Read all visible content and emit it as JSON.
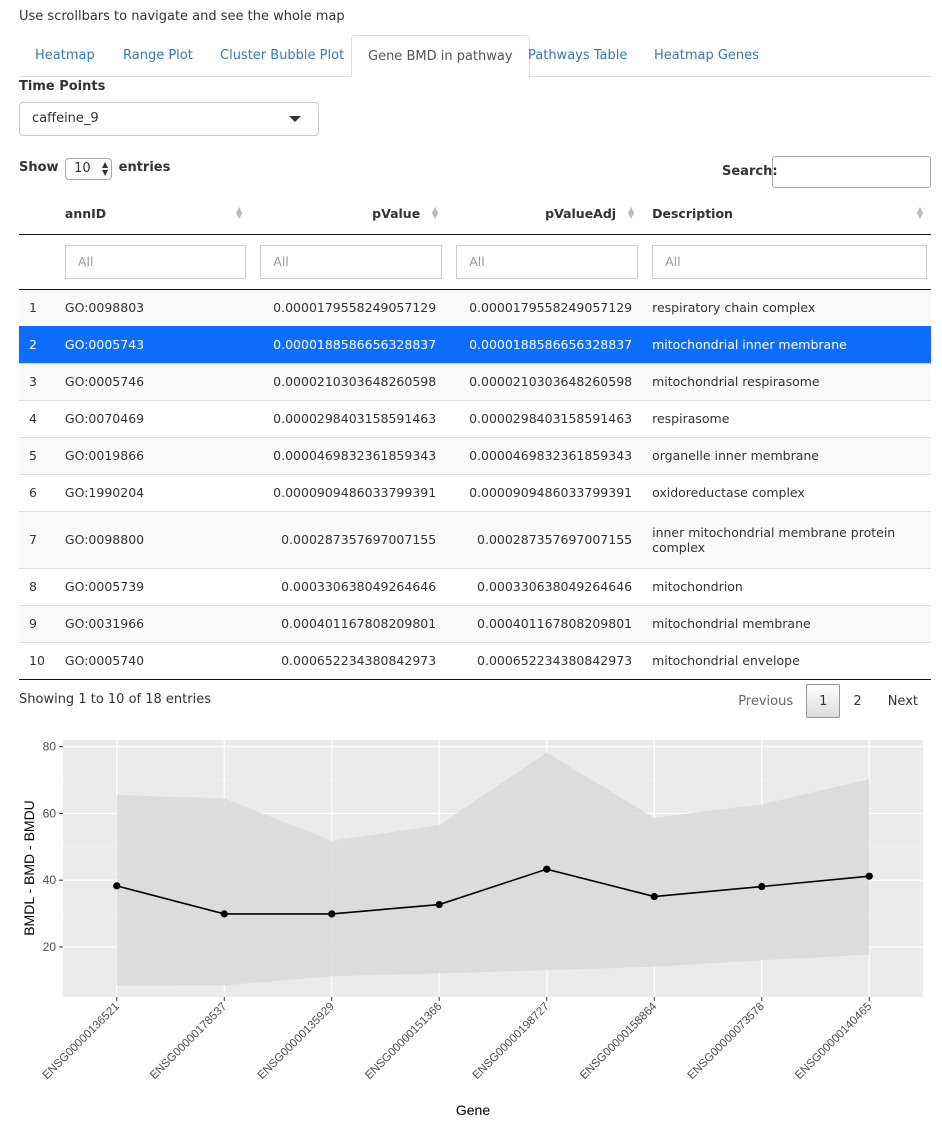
{
  "note": "Use scrollbars to navigate and see the whole map",
  "tabs": [
    "Heatmap",
    "Range Plot",
    "Cluster Bubble Plot",
    "Gene BMD in pathway",
    "Pathways Table",
    "Heatmap Genes"
  ],
  "active_tab": "Gene BMD in pathway",
  "time_points": {
    "label": "Time Points",
    "value": "caffeine_9"
  },
  "table_controls": {
    "show_label": "Show",
    "entries_label": "entries",
    "page_length": "10",
    "search_label": "Search:"
  },
  "columns": [
    "annID",
    "pValue",
    "pValueAdj",
    "Description"
  ],
  "filter_placeholder": "All",
  "rows": [
    {
      "n": "1",
      "annID": "GO:0098803",
      "pValue": "0.0000179558249057129",
      "pValueAdj": "0.0000179558249057129",
      "desc": "respiratory chain complex"
    },
    {
      "n": "2",
      "annID": "GO:0005743",
      "pValue": "0.0000188586656328837",
      "pValueAdj": "0.0000188586656328837",
      "desc": "mitochondrial inner membrane"
    },
    {
      "n": "3",
      "annID": "GO:0005746",
      "pValue": "0.0000210303648260598",
      "pValueAdj": "0.0000210303648260598",
      "desc": "mitochondrial respirasome"
    },
    {
      "n": "4",
      "annID": "GO:0070469",
      "pValue": "0.0000298403158591463",
      "pValueAdj": "0.0000298403158591463",
      "desc": "respirasome"
    },
    {
      "n": "5",
      "annID": "GO:0019866",
      "pValue": "0.0000469832361859343",
      "pValueAdj": "0.0000469832361859343",
      "desc": "organelle inner membrane"
    },
    {
      "n": "6",
      "annID": "GO:1990204",
      "pValue": "0.0000909486033799391",
      "pValueAdj": "0.0000909486033799391",
      "desc": "oxidoreductase complex"
    },
    {
      "n": "7",
      "annID": "GO:0098800",
      "pValue": "0.000287357697007155",
      "pValueAdj": "0.000287357697007155",
      "desc": "inner mitochondrial membrane protein complex"
    },
    {
      "n": "8",
      "annID": "GO:0005739",
      "pValue": "0.000330638049264646",
      "pValueAdj": "0.000330638049264646",
      "desc": "mitochondrion"
    },
    {
      "n": "9",
      "annID": "GO:0031966",
      "pValue": "0.000401167808209801",
      "pValueAdj": "0.000401167808209801",
      "desc": "mitochondrial membrane"
    },
    {
      "n": "10",
      "annID": "GO:0005740",
      "pValue": "0.000652234380842973",
      "pValueAdj": "0.000652234380842973",
      "desc": "mitochondrial envelope"
    }
  ],
  "selected_row": 1,
  "info": "Showing 1 to 10 of 18 entries",
  "pagination": {
    "previous": "Previous",
    "pages": [
      "1",
      "2"
    ],
    "current": "1",
    "next": "Next"
  },
  "colors": {
    "link": "#337ab7",
    "selected_row": "#0d6efd",
    "panel": "#ebebeb",
    "ribbon": "#d9d9d9",
    "line": "#000000"
  },
  "chart_data": {
    "type": "line",
    "xlabel": "Gene",
    "ylabel": "BMDL - BMD - BMDU",
    "categories": [
      "ENSG00000136521",
      "ENSG00000178537",
      "ENSG00000135929",
      "ENSG00000151366",
      "ENSG00000198727",
      "ENSG00000158864",
      "ENSG00000073578",
      "ENSG00000140465"
    ],
    "series": [
      {
        "values": [
          38.3,
          29.9,
          29.9,
          32.7,
          43.3,
          35.1,
          38.1,
          41.2
        ]
      }
    ],
    "band_lower": [
      8.4,
      8.5,
      11.2,
      12.1,
      13.0,
      14.1,
      16.0,
      17.7
    ],
    "band_upper": [
      65.5,
      64.5,
      51.8,
      56.5,
      78.2,
      58.7,
      62.7,
      70.3
    ],
    "yticks": [
      20,
      40,
      60,
      80
    ],
    "ylim": [
      5,
      82
    ],
    "grid": true,
    "legend": "none"
  }
}
